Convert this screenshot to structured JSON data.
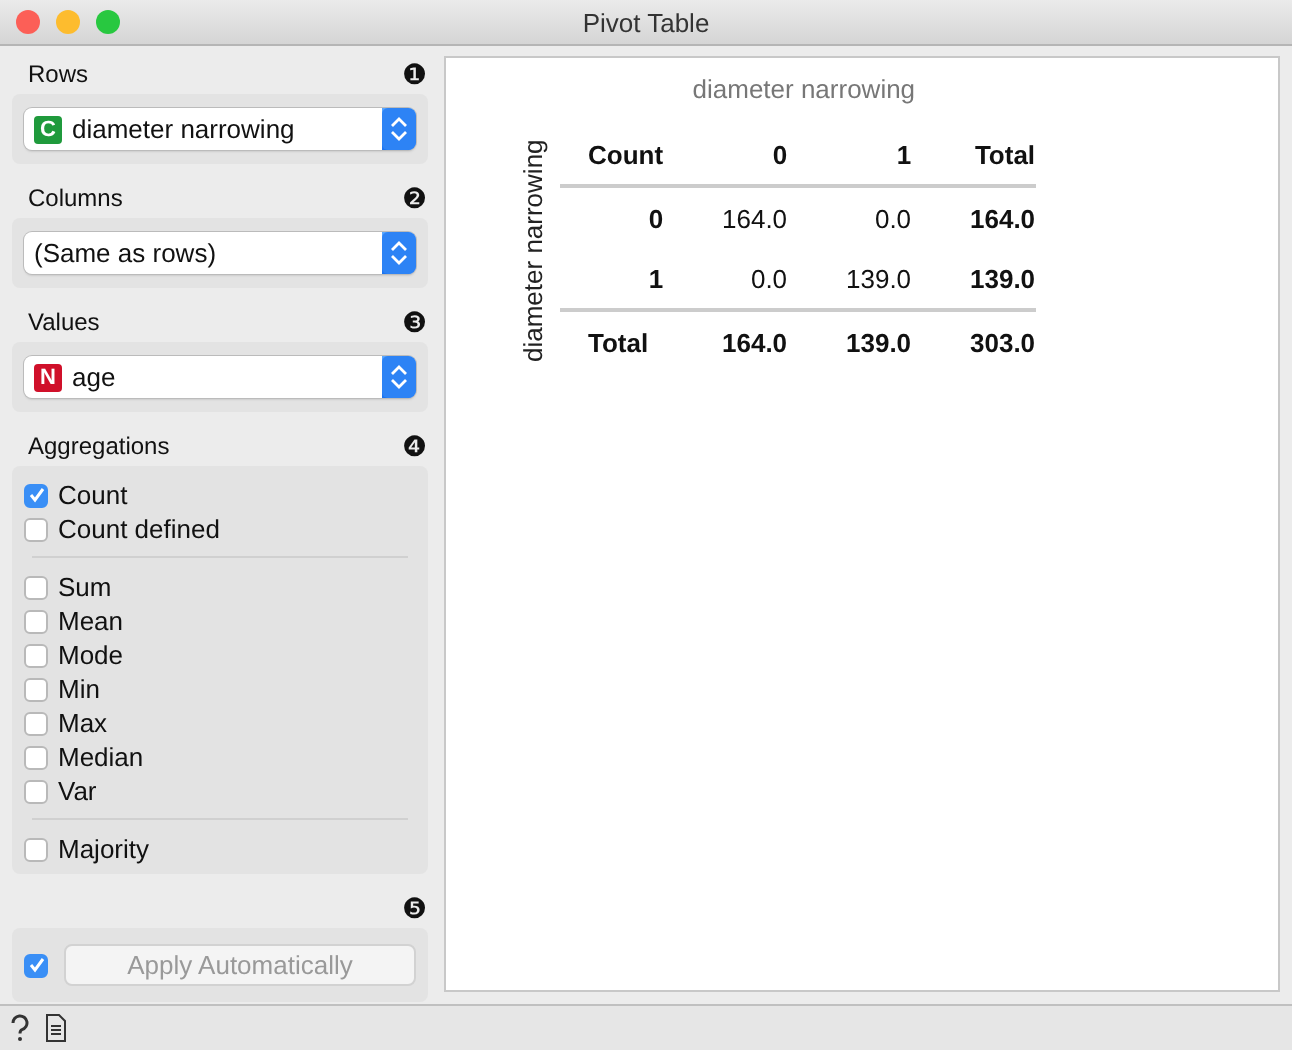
{
  "window": {
    "title": "Pivot Table"
  },
  "selectors": [
    {
      "label": "Rows",
      "callout": "❶",
      "value": "diameter narrowing",
      "badge": "C",
      "color": "#1f9a3c"
    },
    {
      "label": "Columns",
      "callout": "❷",
      "value": "(Same as rows)"
    },
    {
      "label": "Values",
      "callout": "❸",
      "value": "age",
      "badge": "N",
      "color": "#d0102a"
    }
  ],
  "aggregations": {
    "label": "Aggregations",
    "callout": "❹",
    "groups": [
      [
        {
          "label": "Count",
          "checked": true
        },
        {
          "label": "Count defined",
          "checked": false
        }
      ],
      [
        {
          "label": "Sum",
          "checked": false
        },
        {
          "label": "Mean",
          "checked": false
        },
        {
          "label": "Mode",
          "checked": false
        },
        {
          "label": "Min",
          "checked": false
        },
        {
          "label": "Max",
          "checked": false
        },
        {
          "label": "Median",
          "checked": false
        },
        {
          "label": "Var",
          "checked": false
        }
      ],
      [
        {
          "label": "Majority",
          "checked": false
        }
      ]
    ]
  },
  "apply": {
    "callout": "❺",
    "checked": true,
    "label": "Apply Automatically",
    "disabled": true
  },
  "table": {
    "column_title": "diameter narrowing",
    "row_title": "diameter narrowing",
    "corner": "Count",
    "columns": [
      "0",
      "1",
      "Total"
    ],
    "rows": [
      {
        "kind": "data",
        "label": "0",
        "cells": [
          "164.0",
          "0.0",
          "164.0"
        ]
      },
      {
        "kind": "data",
        "label": "1",
        "cells": [
          "0.0",
          "139.0",
          "139.0"
        ]
      },
      {
        "kind": "total",
        "label": "Total",
        "cells": [
          "164.0",
          "139.0",
          "303.0"
        ]
      }
    ]
  }
}
